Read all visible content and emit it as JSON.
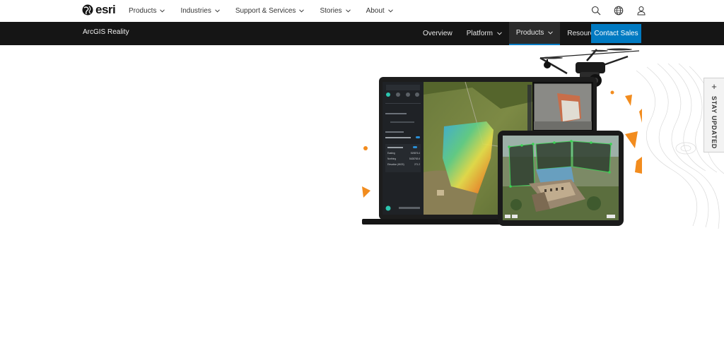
{
  "brand": {
    "logo_text": "esri"
  },
  "global_nav": {
    "items": [
      {
        "label": "Products"
      },
      {
        "label": "Industries"
      },
      {
        "label": "Support & Services"
      },
      {
        "label": "Stories"
      },
      {
        "label": "About"
      }
    ],
    "icons": [
      "search-icon",
      "globe-icon",
      "user-icon"
    ]
  },
  "sub_nav": {
    "title": "ArcGIS Reality",
    "items": [
      {
        "label": "Overview",
        "dropdown": false,
        "active": false
      },
      {
        "label": "Platform",
        "dropdown": true,
        "active": false
      },
      {
        "label": "Products",
        "dropdown": true,
        "active": true
      },
      {
        "label": "Resources",
        "dropdown": false,
        "active": false
      }
    ],
    "cta_label": "Contact Sales"
  },
  "hero": {
    "laptop_panel": {
      "title": "Measurement",
      "rows": [
        {
          "label": "Easting",
          "value": "519876.4"
        },
        {
          "label": "Northing",
          "value": "5428763.6"
        },
        {
          "label": "Elevation (WGS)",
          "value": "271.2"
        }
      ]
    }
  },
  "stay_updated": {
    "label": "STAY UPDATED"
  },
  "colors": {
    "brand_blue": "#007ac2",
    "subnav_bg": "#151515",
    "accent_orange": "#f28c1e"
  }
}
